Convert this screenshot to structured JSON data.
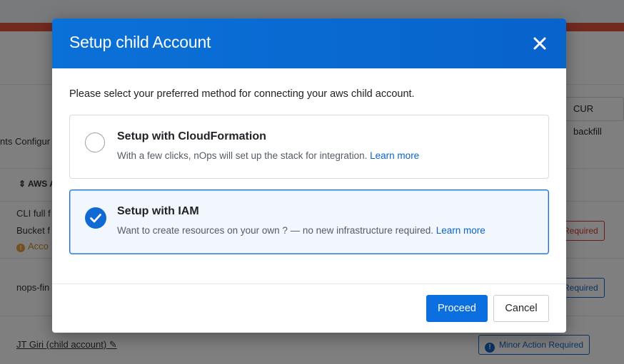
{
  "background": {
    "cur_button": "CUR backfill",
    "left_header": "nts Configur",
    "col_header": "AWS A",
    "rows": [
      {
        "line1": "CLI full f",
        "line2": "Bucket f",
        "line3": "Acco",
        "badge": "Required"
      },
      {
        "line1": "nops-fin",
        "badge": "Required"
      },
      {
        "line1": "JT Giri (child account)",
        "badge": "Minor Action Required"
      }
    ]
  },
  "modal": {
    "title": "Setup child Account",
    "prompt": "Please select your preferred method for connecting your aws child account.",
    "options": [
      {
        "title": "Setup with CloudFormation",
        "description": "With a few clicks, nOps will set up the stack for integration.",
        "link": "Learn more",
        "selected": false
      },
      {
        "title": "Setup with IAM",
        "description": "Want to create resources on your own ? — no new infrastructure required.",
        "link": "Learn more",
        "selected": true
      }
    ],
    "proceed_label": "Proceed",
    "cancel_label": "Cancel"
  },
  "colors": {
    "header_blue": "#0a71d8",
    "primary_button": "#0b6fe0",
    "selected_border": "#1d6fd4",
    "link": "#0b63c9"
  }
}
